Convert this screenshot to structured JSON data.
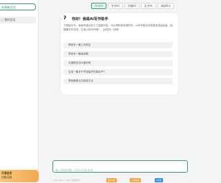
{
  "sidebar": {
    "new_chat_label": "创建新会话",
    "conversation": {
      "icon": "chat-bubble-icon",
      "title": "我的会话"
    },
    "vip": {
      "line1": "开通会员",
      "line2": "次数无限"
    }
  },
  "tabs": [
    {
      "label": "字词AI",
      "active": true
    },
    {
      "label": "字节AI",
      "active": false
    },
    {
      "label": "字稿AI",
      "active": false
    },
    {
      "label": "无才AI",
      "active": false
    },
    {
      "label": "体网Pro",
      "active": false
    }
  ],
  "welcome": {
    "greeting": "你好！我是AI写作助手",
    "intro": "万物皆可写，我就有强大的人工智能问答，可以帮助你处理写作，AI写作助手还有更多用途功能（如图像写作任务、生成小说写作等），赶快试一试吧！",
    "prompts": [
      "帮我写一篇工作报告",
      "帮我写一篇演讲稿",
      "月度账目怎么做好呢",
      "生成一篇关于环境保护的演讲PPT",
      "帮我看看论文新增方法"
    ]
  },
  "composer": {
    "placeholder": "输入您的问题，Ctrl+回车发送"
  },
  "footer": {
    "text": "Copyright © 2023 版权所有",
    "badges": [
      "浙ICP备",
      "公安备案",
      "ICP证"
    ]
  },
  "colors": {
    "accent": "#2f9e6f",
    "vip_start": "#f7c884",
    "vip_end": "#f4a84a"
  }
}
